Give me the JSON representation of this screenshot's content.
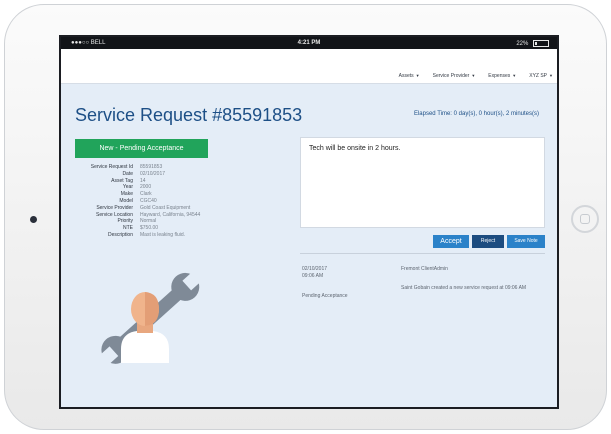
{
  "status_bar": {
    "carrier": "●●●○○ BELL",
    "time": "4:21 PM",
    "battery": "22%"
  },
  "nav": {
    "items": [
      "Assets",
      "Service Provider",
      "Expenses",
      "XYZ SP"
    ]
  },
  "page": {
    "title": "Service Request #85591853",
    "elapsed": "Elapsed Time: 0 day(s), 0 hour(s), 2 minutes(s)"
  },
  "status_badge": "New - Pending Acceptance",
  "details": [
    {
      "label": "Service Request Id",
      "value": "85591853"
    },
    {
      "label": "Date",
      "value": "02/10/2017"
    },
    {
      "label": "Asset Tag",
      "value": "14"
    },
    {
      "label": "Year",
      "value": "2000"
    },
    {
      "label": "Make",
      "value": "Clark"
    },
    {
      "label": "Model",
      "value": "CGC40"
    },
    {
      "label": "Service Provider",
      "value": "Gold Coast Equipment"
    },
    {
      "label": "Service Location",
      "value": "Hayward, California, 94544"
    },
    {
      "label": "Priority",
      "value": "Normal"
    },
    {
      "label": "NTE",
      "value": "$750.00"
    },
    {
      "label": "Description",
      "value": "Mast is leaking fluid."
    }
  ],
  "note": {
    "text": "Tech will be onsite in 2 hours."
  },
  "buttons": {
    "accept": "Accept",
    "reject": "Reject",
    "save": "Save Note"
  },
  "log": {
    "date": "02/10/2017",
    "time": "09:06 AM",
    "user": "Fremont ClientAdmin",
    "message": "Saint Gobain created a new service request at 09:06 AM",
    "status": "Pending Acceptance"
  },
  "colors": {
    "accent": "#2b82c9",
    "title": "#1d4f86",
    "badge": "#21a45b",
    "screen_bg": "#e4edf7"
  }
}
